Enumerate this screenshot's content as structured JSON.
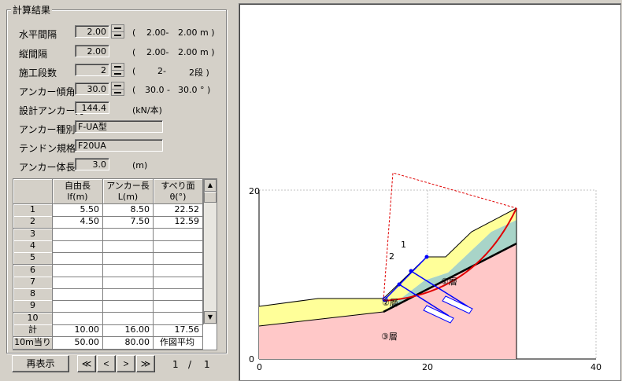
{
  "panel": {
    "title": "計算結果"
  },
  "params": {
    "horiz": {
      "label": "水平間隔",
      "value": "2.00",
      "range_open": "(",
      "range": "2.00-",
      "range_max": "2.00 m )"
    },
    "vert": {
      "label": "縦間隔",
      "value": "2.00",
      "range_open": "(",
      "range": "2.00-",
      "range_max": "2.00 m )"
    },
    "stages": {
      "label": "施工段数",
      "value": "2",
      "range_open": "(",
      "range": "2-",
      "range_max": "2段 )"
    },
    "tilt": {
      "label": "アンカー傾角",
      "value": "30.0",
      "range_open": "(",
      "range": "30.0 -",
      "range_max": "30.0 ° )"
    },
    "design_force": {
      "label": "設計アンカー力",
      "value": "144.4",
      "unit": "(kN/本)"
    },
    "anchor_type": {
      "label": "アンカー種別",
      "value": "F-UA型"
    },
    "tendon": {
      "label": "テンドン規格",
      "value": "F20UA"
    },
    "body_len": {
      "label": "アンカー体長",
      "value": "3.0",
      "unit": "(m)"
    }
  },
  "table": {
    "headers": [
      {
        "l1": "自由長",
        "l2": "lf(m)"
      },
      {
        "l1": "アンカー長",
        "l2": "L(m)"
      },
      {
        "l1": "すべり面",
        "l2": "θ(°)"
      }
    ],
    "rows": [
      {
        "no": "1",
        "c1": "5.50",
        "c2": "8.50",
        "c3": "22.52"
      },
      {
        "no": "2",
        "c1": "4.50",
        "c2": "7.50",
        "c3": "12.59"
      },
      {
        "no": "3",
        "c1": "",
        "c2": "",
        "c3": ""
      },
      {
        "no": "4",
        "c1": "",
        "c2": "",
        "c3": ""
      },
      {
        "no": "5",
        "c1": "",
        "c2": "",
        "c3": ""
      },
      {
        "no": "6",
        "c1": "",
        "c2": "",
        "c3": ""
      },
      {
        "no": "7",
        "c1": "",
        "c2": "",
        "c3": ""
      },
      {
        "no": "8",
        "c1": "",
        "c2": "",
        "c3": ""
      },
      {
        "no": "9",
        "c1": "",
        "c2": "",
        "c3": ""
      },
      {
        "no": "10",
        "c1": "",
        "c2": "",
        "c3": ""
      }
    ],
    "total": {
      "label": "計",
      "c1": "10.00",
      "c2": "16.00",
      "c3": "17.56"
    },
    "per10": {
      "label": "10m当り",
      "c1": "50.00",
      "c2": "80.00",
      "c3": "作図平均"
    }
  },
  "buttons": {
    "redisplay": "再表示",
    "first": "≪",
    "prev": "<",
    "next": ">",
    "last": "≫"
  },
  "pager": {
    "current": "1",
    "sep": "/",
    "total": "1"
  },
  "plot": {
    "xticks": [
      "0",
      "20",
      "40"
    ],
    "yticks": [
      "0",
      "20"
    ],
    "layer1": "①層",
    "layer2": "②層",
    "layer3": "③層",
    "ann1": "1",
    "ann2": "2",
    "colors": {
      "layer1": "#ffff99",
      "layer2": "#a8d4c8",
      "layer3": "#ffc8c8",
      "slip": "#e00000",
      "anchor": "#0000ff"
    }
  }
}
